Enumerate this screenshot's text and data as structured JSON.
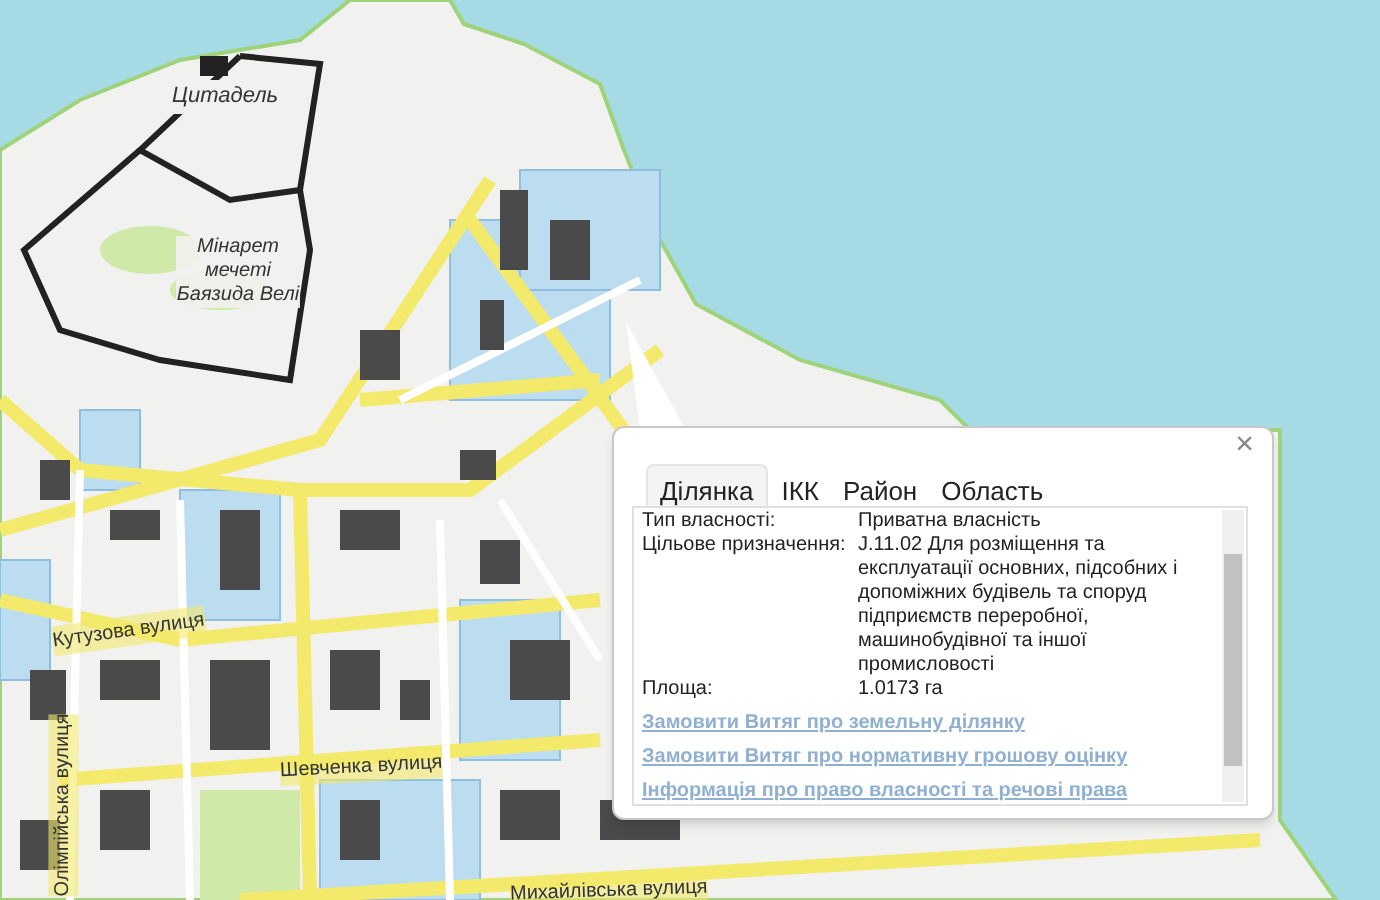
{
  "map": {
    "labels": [
      {
        "text": "Цитадель",
        "kind": "place"
      },
      {
        "text": "Мінарет мечеті Баязида Велі",
        "kind": "place"
      },
      {
        "text": "Кутузова вулиця",
        "kind": "street"
      },
      {
        "text": "Шевченка вулиця",
        "kind": "street"
      },
      {
        "text": "Олімпійська вулиця",
        "kind": "street"
      },
      {
        "text": "Михайлівська вулиця",
        "kind": "street"
      }
    ]
  },
  "popup": {
    "close": "×",
    "tabs": [
      {
        "label": "Ділянка",
        "selected": true
      },
      {
        "label": "ІКК",
        "selected": false
      },
      {
        "label": "Район",
        "selected": false
      },
      {
        "label": "Область",
        "selected": false
      }
    ],
    "fields": [
      {
        "label": "Тип власності:",
        "value": "Приватна власність"
      },
      {
        "label": "Цільове призначення:",
        "value": "J.11.02 Для розміщення та експлуатації основних, підсобних і допоміжних будівель та споруд підприємств переробної, машинобудівної та іншої промисловості"
      },
      {
        "label": "Площа:",
        "value": "1.0173 га"
      }
    ],
    "links": [
      "Замовити Витяг про земельну ділянку",
      "Замовити Витяг про нормативну грошову оцінку",
      "Інформація про право власності та речові права"
    ]
  }
}
